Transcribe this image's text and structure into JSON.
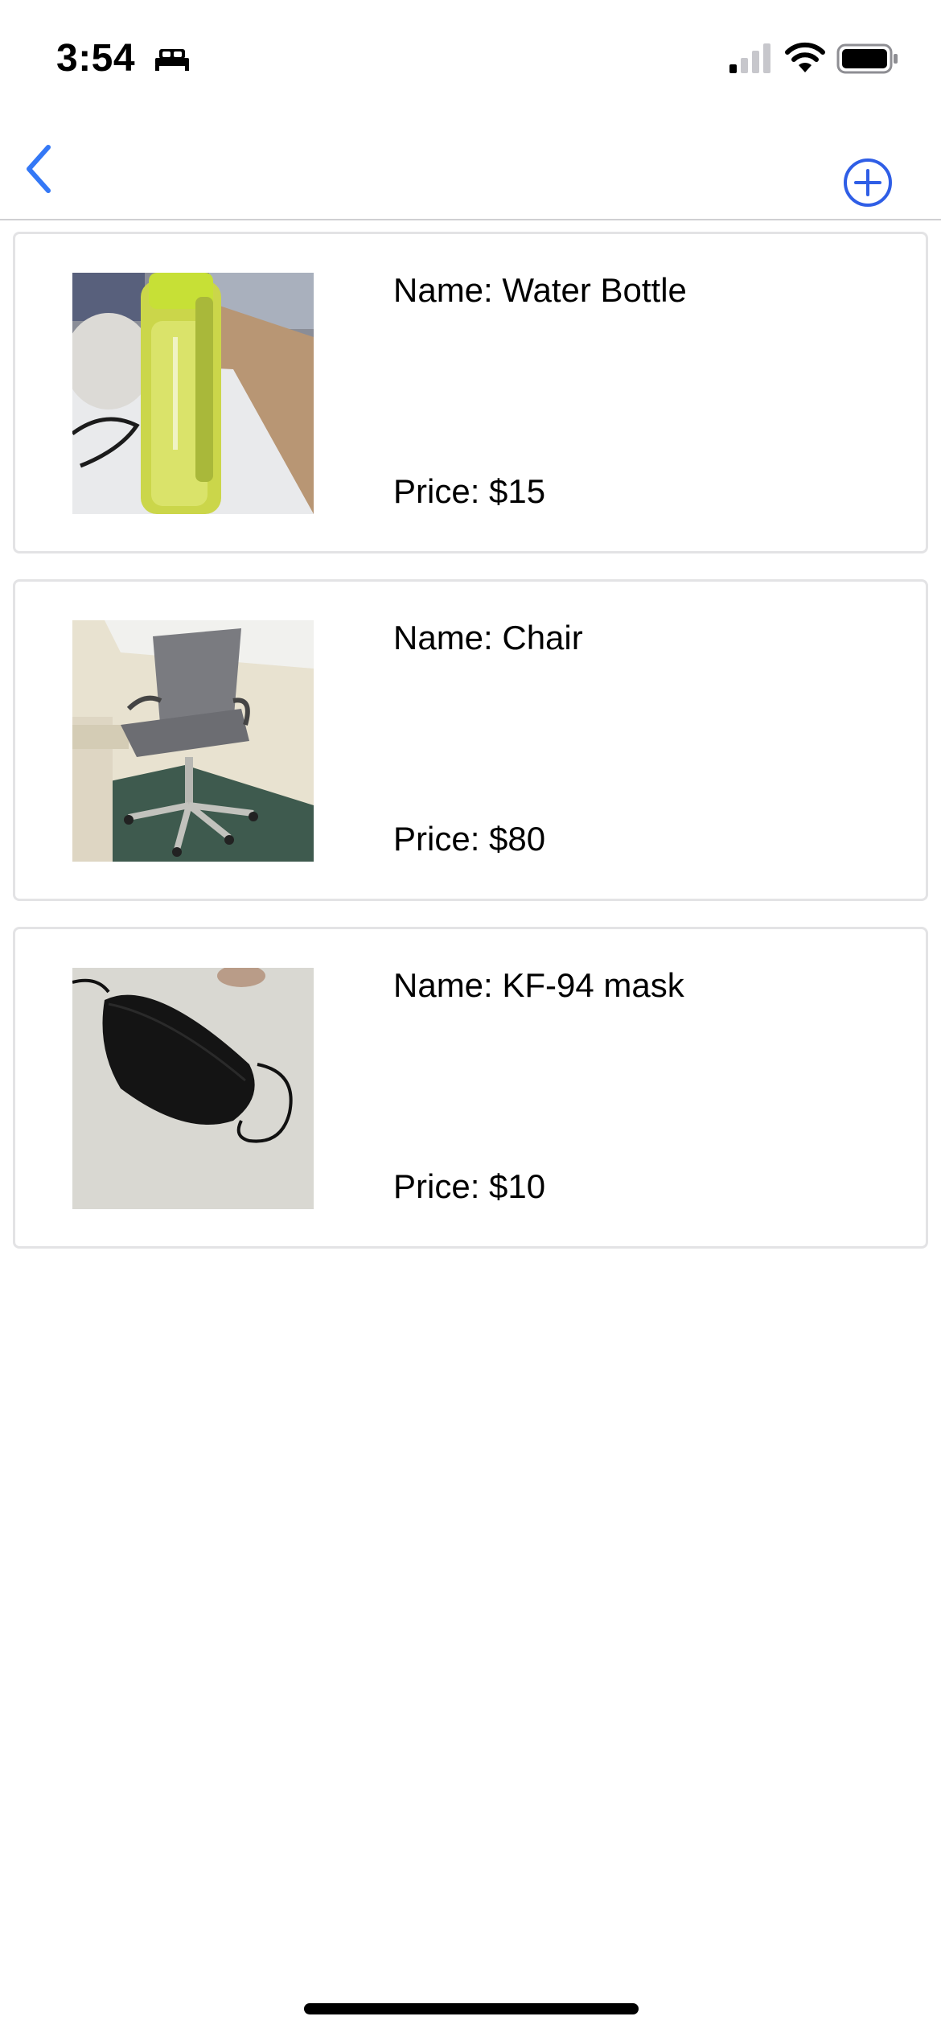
{
  "status_bar": {
    "time": "3:54",
    "focus_icon": "bed-icon",
    "signal_icon": "cellular-signal-icon",
    "wifi_icon": "wifi-icon",
    "battery_icon": "battery-icon"
  },
  "nav": {
    "back_icon": "chevron-left-icon",
    "add_icon": "plus-circle-icon",
    "accent_color": "#3478f6"
  },
  "items": [
    {
      "name": "Name: Water Bottle",
      "price": "Price: $15",
      "image": "water-bottle-photo"
    },
    {
      "name": "Name: Chair",
      "price": "Price: $80",
      "image": "chair-photo"
    },
    {
      "name": "Name: KF-94 mask",
      "price": "Price: $10",
      "image": "mask-photo"
    }
  ]
}
